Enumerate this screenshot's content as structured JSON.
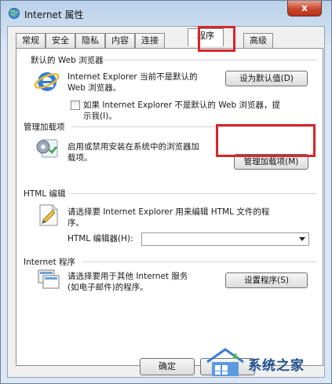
{
  "window": {
    "title": "Internet 属性",
    "close_glyph": "x",
    "icon": "internet-globe-icon"
  },
  "tabs": [
    {
      "label": "常规"
    },
    {
      "label": "安全"
    },
    {
      "label": "隐私"
    },
    {
      "label": "内容"
    },
    {
      "label": "连接"
    },
    {
      "label": "程序",
      "active": true
    },
    {
      "label": "高级"
    }
  ],
  "sections": {
    "default_browser": {
      "title": "默认的 Web 浏览器",
      "icon": "internet-explorer-icon",
      "line1": "Internet Explorer 当前不是默认的",
      "line2": "Web 浏览器。",
      "button": "设为默认值(D)",
      "check_line1": "如果 Internet Explorer 不是默认的 Web 浏览器，提",
      "check_line2": "示我(I)。",
      "checked": false
    },
    "addons": {
      "title": "管理加载项",
      "icon": "addons-gear-icon",
      "line1": "启用或禁用安装在系统中的浏览器加",
      "line2": "载项。",
      "button": "管理加载项(M)"
    },
    "html_editing": {
      "title": "HTML 编辑",
      "icon": "html-editor-icon",
      "line1": "请选择要 Internet Explorer 用来编辑 HTML 文件的程",
      "line2": "序。",
      "editor_label": "HTML 编辑器(H):",
      "editor_value": ""
    },
    "programs": {
      "title": "Internet 程序",
      "icon": "internet-programs-icon",
      "line1": "请选择要用于其他 Internet 服务",
      "line2": "(如电子邮件)的程序。",
      "button": "设置程序(S)"
    }
  },
  "footer": {
    "ok": "确定",
    "cancel": "取消"
  },
  "watermark": {
    "text": "系统之家"
  },
  "colors": {
    "highlight": "#d7262b",
    "titlebar": "#b9d1ea",
    "close": "#c9462b"
  }
}
